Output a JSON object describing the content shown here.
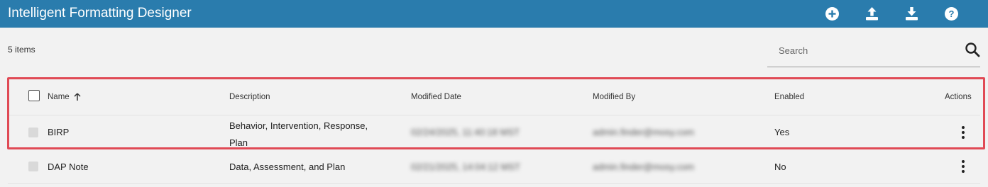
{
  "header": {
    "title": "Intelligent Formatting Designer",
    "icons": [
      "add-icon",
      "upload-icon",
      "download-icon",
      "help-icon"
    ]
  },
  "toolbar": {
    "item_count": "5 items",
    "search_placeholder": "Search"
  },
  "table": {
    "columns": {
      "name": "Name",
      "description": "Description",
      "modified_date": "Modified Date",
      "modified_by": "Modified By",
      "enabled": "Enabled",
      "actions": "Actions"
    },
    "rows": [
      {
        "name": "BIRP",
        "description_line1": "Behavior, Intervention, Response,",
        "description_line2": "Plan",
        "modified_date": "02/24/2025, 11:40:18 MST",
        "modified_by": "admin.finder@mosy.com",
        "enabled": "Yes"
      },
      {
        "name": "DAP Note",
        "description": "Data, Assessment, and Plan",
        "modified_date": "02/21/2025, 14:04:12 MST",
        "modified_by": "admin.finder@mosy.com",
        "enabled": "No"
      }
    ]
  },
  "colors": {
    "header_bg": "#2a7cad",
    "highlight": "#e04a55",
    "page_bg": "#f2f2f2"
  }
}
